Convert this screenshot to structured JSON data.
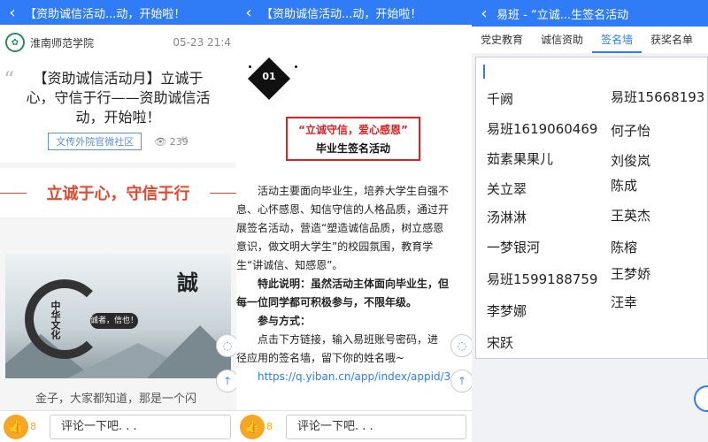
{
  "panel1": {
    "topbar": {
      "title": "【资助诚信活动...动，开始啦！"
    },
    "school": {
      "name": "淮南师范学院",
      "date": "05-23 21:4"
    },
    "article": {
      "title_lines": [
        "【资助诚信活动月】立诚于",
        "心，守信于行——资助诚信活",
        "动，开始啦！"
      ],
      "tag": "文传外院官微社区",
      "views": "239"
    },
    "banner": "立诚于心，守信于行",
    "painting": {
      "big_char": "誠",
      "vertical": "中华文化",
      "seal": "诚者，信也！"
    },
    "body_text": "金子，大家都知道，那是一个闪",
    "bottom": {
      "likes": "8",
      "comment_placeholder": "评论一下吧. . ."
    }
  },
  "panel2": {
    "topbar": {
      "title": "【资助诚信活动...动，开始啦！"
    },
    "badge": "01",
    "box": {
      "line1": "“立诚守信，爱心感恩”",
      "line2": "毕业生签名活动"
    },
    "lines": [
      "　　活动主要面向毕业生，培养大学生自强不",
      "息、心怀感恩、知信守信的人格品质，通过开",
      "展签名活动，营造“塑造诚信品质，树立感恩",
      "意识，做文明大学生”的校园氛围，教育学",
      "生“讲诚信、知感恩”。",
      "　　特此说明：虽然活动主体面向毕业生，但",
      "每一位同学都可积极参与，不限年级。",
      "　　参与方式：",
      "　　点击下方链接，输入易班账号密码，进",
      "径应用的签名墙，留下你的姓名哦~",
      "　　https://q.yiban.cn/app/index/appid/3"
    ],
    "bottom": {
      "likes": "8",
      "comment_placeholder": "评论一下吧. . ."
    }
  },
  "panel3": {
    "topbar": {
      "title": "易班 - “立诚...生签名活动"
    },
    "tabs": [
      "党史教育",
      "诚信资助",
      "签名墙",
      "获奖名单"
    ],
    "active_tab": "签名墙",
    "names_left": [
      "千阙",
      "易班1619060469",
      "茹素果果儿",
      "关立翠",
      "汤淋淋",
      "一梦银河",
      "易班1599188759",
      "李梦娜",
      "宋跃"
    ],
    "names_right": [
      "易班15668193",
      "何子怡",
      "刘俊岚",
      "陈成",
      "王英杰",
      "陈榕",
      "王梦娇",
      "汪幸"
    ]
  },
  "colors": {
    "accent": "#2f7cf6",
    "banner_red": "#e2482e",
    "like": "#f5a623"
  }
}
